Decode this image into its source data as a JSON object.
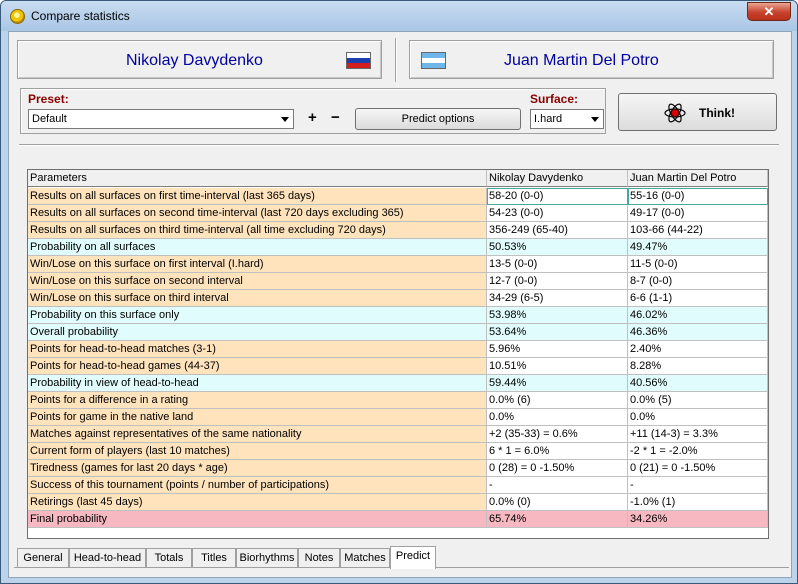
{
  "window": {
    "title": "Compare statistics",
    "close_label": "✕"
  },
  "players": {
    "p1": {
      "name": "Nikolay Davydenko",
      "flag": "russia-flag-icon"
    },
    "p2": {
      "name": "Juan Martin Del Potro",
      "flag": "argentina-flag-icon"
    }
  },
  "options": {
    "preset_label": "Preset:",
    "preset_value": "Default",
    "plus_label": "+",
    "minus_label": "−",
    "predict_options_label": "Predict options",
    "surface_label": "Surface:",
    "surface_value": "I.hard",
    "think_label": "Think!"
  },
  "colors": {
    "orange": "#ffe3bc",
    "cyan": "#e0fcfc",
    "pink": "#f7b8c2",
    "white": "#ffffff"
  },
  "table": {
    "headers": [
      "Parameters",
      "Nikolay Davydenko",
      "Juan Martin Del Potro"
    ],
    "rows": [
      {
        "param": "Results on all surfaces on first time-interval (last 365 days)",
        "p1": "58-20 (0-0)",
        "p2": "55-16 (0-0)",
        "color": "orange"
      },
      {
        "param": "Results on all surfaces on second time-interval (last 720 days excluding 365)",
        "p1": "54-23 (0-0)",
        "p2": "49-17 (0-0)",
        "color": "orange"
      },
      {
        "param": "Results on all surfaces on third time-interval (all time excluding 720 days)",
        "p1": "356-249 (65-40)",
        "p2": "103-66 (44-22)",
        "color": "orange"
      },
      {
        "param": "Probability on all surfaces",
        "p1": "50.53%",
        "p2": "49.47%",
        "color": "cyan"
      },
      {
        "param": "Win/Lose on this surface on first interval (I.hard)",
        "p1": "13-5 (0-0)",
        "p2": "11-5 (0-0)",
        "color": "orange"
      },
      {
        "param": "Win/Lose on this surface on second interval",
        "p1": "12-7 (0-0)",
        "p2": "8-7 (0-0)",
        "color": "orange"
      },
      {
        "param": "Win/Lose on this surface on third interval",
        "p1": "34-29 (6-5)",
        "p2": "6-6 (1-1)",
        "color": "orange"
      },
      {
        "param": "Probability on this surface only",
        "p1": "53.98%",
        "p2": "46.02%",
        "color": "cyan"
      },
      {
        "param": "Overall probability",
        "p1": "53.64%",
        "p2": "46.36%",
        "color": "cyan"
      },
      {
        "param": "Points for head-to-head matches (3-1)",
        "p1": "5.96%",
        "p2": "2.40%",
        "color": "orange"
      },
      {
        "param": "Points for head-to-head games (44-37)",
        "p1": "10.51%",
        "p2": "8.28%",
        "color": "orange"
      },
      {
        "param": "Probability in view of head-to-head",
        "p1": "59.44%",
        "p2": "40.56%",
        "color": "cyan"
      },
      {
        "param": "Points for a difference in a rating",
        "p1": "0.0% (6)",
        "p2": "0.0% (5)",
        "color": "orange"
      },
      {
        "param": "Points for game in the native land",
        "p1": "0.0%",
        "p2": "0.0%",
        "color": "orange"
      },
      {
        "param": "Matches against representatives of the same nationality",
        "p1": "+2 (35-33) = 0.6%",
        "p2": "+11 (14-3) = 3.3%",
        "color": "orange"
      },
      {
        "param": "Current form of players (last 10 matches)",
        "p1": "6 * 1 = 6.0%",
        "p2": "-2 * 1 = -2.0%",
        "color": "orange"
      },
      {
        "param": "Tiredness (games for last 20 days * age)",
        "p1": "0 (28) = 0     -1.50%",
        "p2": "0 (21) = 0     -1.50%",
        "color": "orange"
      },
      {
        "param": "Success of this tournament (points / number of participations)",
        "p1": "-",
        "p2": "-",
        "color": "orange"
      },
      {
        "param": "Retirings (last 45 days)",
        "p1": "0.0% (0)",
        "p2": "-1.0% (1)",
        "color": "orange"
      },
      {
        "param": "Final probability",
        "p1": "65.74%",
        "p2": "34.26%",
        "color": "pink"
      }
    ]
  },
  "tabs": [
    {
      "label": "General",
      "active": false
    },
    {
      "label": "Head-to-head",
      "active": false
    },
    {
      "label": "Totals",
      "active": false
    },
    {
      "label": "Titles",
      "active": false
    },
    {
      "label": "Biorhythms",
      "active": false
    },
    {
      "label": "Notes",
      "active": false
    },
    {
      "label": "Matches",
      "active": false
    },
    {
      "label": "Predict",
      "active": true
    }
  ]
}
